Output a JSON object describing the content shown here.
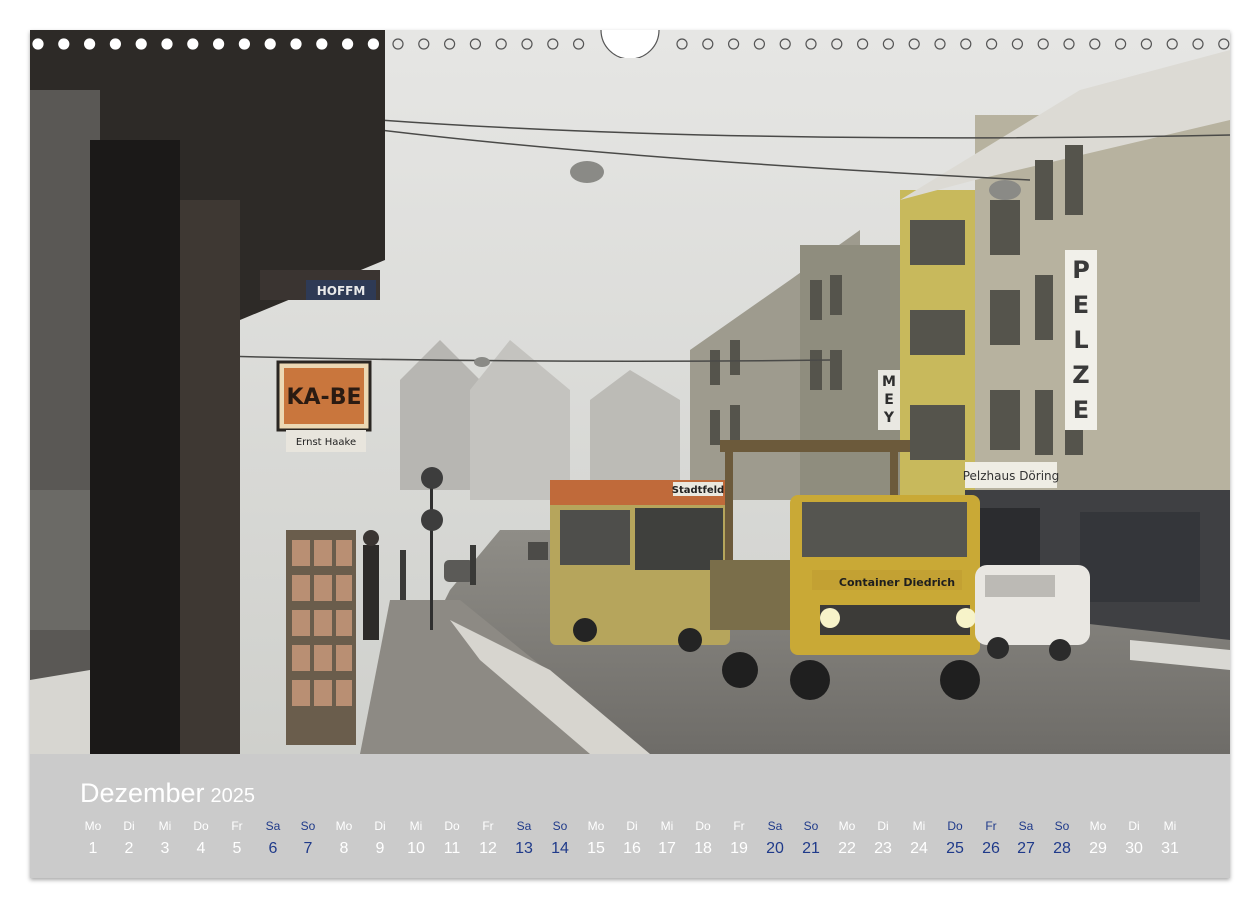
{
  "photo": {
    "description_icon": "photo-icon",
    "signs": {
      "kabe_top": "KA-BE",
      "hoffm": "HOFFM",
      "ernst": "Ernst Haake",
      "stadtfeld": "Stadtfeld",
      "container": "Container Diedrich",
      "pelze": [
        "P",
        "E",
        "L",
        "Z",
        "E"
      ],
      "pelzhaus": "Pelzhaus Döring",
      "mey": [
        "M",
        "E",
        "Y"
      ]
    }
  },
  "calendar": {
    "month": "Dezember",
    "year": "2025",
    "weekend_color": "#1f3a8a",
    "days": [
      {
        "dn": "Mo",
        "num": "1",
        "we": false
      },
      {
        "dn": "Di",
        "num": "2",
        "we": false
      },
      {
        "dn": "Mi",
        "num": "3",
        "we": false
      },
      {
        "dn": "Do",
        "num": "4",
        "we": false
      },
      {
        "dn": "Fr",
        "num": "5",
        "we": false
      },
      {
        "dn": "Sa",
        "num": "6",
        "we": true
      },
      {
        "dn": "So",
        "num": "7",
        "we": true
      },
      {
        "dn": "Mo",
        "num": "8",
        "we": false
      },
      {
        "dn": "Di",
        "num": "9",
        "we": false
      },
      {
        "dn": "Mi",
        "num": "10",
        "we": false
      },
      {
        "dn": "Do",
        "num": "11",
        "we": false
      },
      {
        "dn": "Fr",
        "num": "12",
        "we": false
      },
      {
        "dn": "Sa",
        "num": "13",
        "we": true
      },
      {
        "dn": "So",
        "num": "14",
        "we": true
      },
      {
        "dn": "Mo",
        "num": "15",
        "we": false
      },
      {
        "dn": "Di",
        "num": "16",
        "we": false
      },
      {
        "dn": "Mi",
        "num": "17",
        "we": false
      },
      {
        "dn": "Do",
        "num": "18",
        "we": false
      },
      {
        "dn": "Fr",
        "num": "19",
        "we": false
      },
      {
        "dn": "Sa",
        "num": "20",
        "we": true
      },
      {
        "dn": "So",
        "num": "21",
        "we": true
      },
      {
        "dn": "Mo",
        "num": "22",
        "we": false
      },
      {
        "dn": "Di",
        "num": "23",
        "we": false
      },
      {
        "dn": "Mi",
        "num": "24",
        "we": false
      },
      {
        "dn": "Do",
        "num": "25",
        "we": true
      },
      {
        "dn": "Fr",
        "num": "26",
        "we": true
      },
      {
        "dn": "Sa",
        "num": "27",
        "we": true
      },
      {
        "dn": "So",
        "num": "28",
        "we": true
      },
      {
        "dn": "Mo",
        "num": "29",
        "we": false
      },
      {
        "dn": "Di",
        "num": "30",
        "we": false
      },
      {
        "dn": "Mi",
        "num": "31",
        "we": false
      }
    ]
  }
}
